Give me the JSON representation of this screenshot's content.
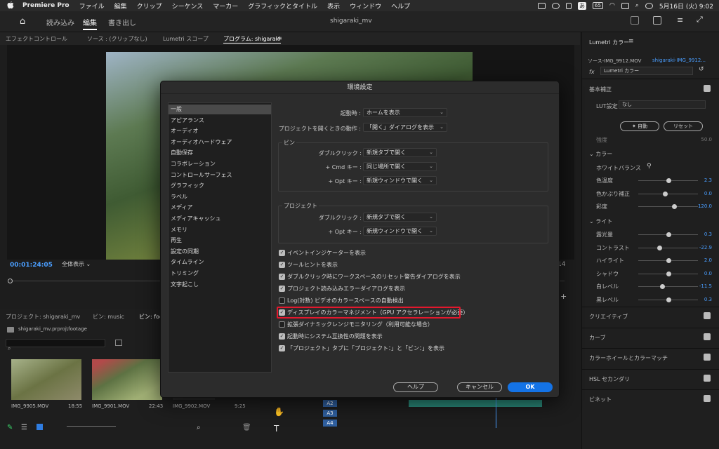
{
  "menubar": {
    "app": "Premiere Pro",
    "items": [
      "ファイル",
      "編集",
      "クリップ",
      "シーケンス",
      "マーカー",
      "グラフィックとタイトル",
      "表示",
      "ウィンドウ",
      "ヘルプ"
    ],
    "clock": "5月16日 (火)  9:02",
    "input_mode": "あ",
    "battery": "65"
  },
  "header": {
    "tabs": [
      "読み込み",
      "編集",
      "書き出し"
    ],
    "project": "shigaraki_mv"
  },
  "program": {
    "tabs": [
      "エフェクトコントロール",
      "ソース : (クリップなし)",
      "Lumetri スコープ",
      "プログラム: shigaraki"
    ],
    "timecode": "00:01:24:05",
    "zoom": "全体表示",
    "right_tc": "14"
  },
  "project": {
    "tabs": [
      "プロジェクト: shigaraki_mv",
      "ビン: music",
      "ビン: foo"
    ],
    "path": "shigaraki_mv.prproj\\footage",
    "clips": [
      {
        "name": "IMG_9905.MOV",
        "dur": "18:55"
      },
      {
        "name": "IMG_9901.MOV",
        "dur": "22:43"
      },
      {
        "name": "IMG_9902.MOV",
        "dur": "9:25"
      }
    ]
  },
  "lumetri": {
    "title": "Lumetri カラー",
    "source": "ソース-IMG_9912.MOV",
    "seq": "shigaraki-IMG_9912...",
    "fx": "Lumetri カラー",
    "basic": "基本補正",
    "lut_label": "LUT設定",
    "lut_value": "なし",
    "auto": "自動",
    "reset": "リセット",
    "intensity": "強度",
    "intensity_val": "50.0",
    "color": "カラー",
    "wb": "ホワイトバランス",
    "rows": [
      {
        "label": "色温度",
        "value": "2.3",
        "pos": 0.5
      },
      {
        "label": "色かぶり補正",
        "value": "0.0",
        "pos": 0.45
      },
      {
        "label": "彩度",
        "value": "120.0",
        "pos": 0.6
      }
    ],
    "light": "ライト",
    "light_rows": [
      {
        "label": "露光量",
        "value": "0.3",
        "pos": 0.5
      },
      {
        "label": "コントラスト",
        "value": "-22.9",
        "pos": 0.35
      },
      {
        "label": "ハイライト",
        "value": "2.0",
        "pos": 0.5
      },
      {
        "label": "シャドウ",
        "value": "0.0",
        "pos": 0.5
      },
      {
        "label": "白レベル",
        "value": "-11.5",
        "pos": 0.4
      },
      {
        "label": "黒レベル",
        "value": "0.3",
        "pos": 0.5
      }
    ],
    "sections": [
      "クリエイティブ",
      "カーブ",
      "カラーホイールとカラーマッチ",
      "HSL セカンダリ",
      "ビネット"
    ]
  },
  "timeline": {
    "tracks": [
      "A2",
      "A3",
      "A4"
    ]
  },
  "dialog": {
    "title": "環境設定",
    "categories": [
      "一般",
      "アピアランス",
      "オーディオ",
      "オーディオハードウェア",
      "自動保存",
      "コラボレーション",
      "コントロールサーフェス",
      "グラフィック",
      "ラベル",
      "メディア",
      "メディアキャッシュ",
      "メモリ",
      "再生",
      "設定の同期",
      "タイムライン",
      "トリミング",
      "文字起こし"
    ],
    "startup_label": "起動時 :",
    "startup_value": "ホームを表示",
    "open_label": "プロジェクトを開くときの動作 :",
    "open_value": "「開く」ダイアログを表示",
    "bin_title": "ビン",
    "bin_rows": [
      {
        "label": "ダブルクリック :",
        "value": "新規タブで開く"
      },
      {
        "label": "+ Cmd キー :",
        "value": "同じ場所で開く"
      },
      {
        "label": "+ Opt キー :",
        "value": "新規ウィンドウで開く"
      }
    ],
    "project_title": "プロジェクト",
    "project_rows": [
      {
        "label": "ダブルクリック :",
        "value": "新規タブで開く"
      },
      {
        "label": "+ Opt キー :",
        "value": "新規ウィンドウで開く"
      }
    ],
    "checks": [
      {
        "label": "イベントインジケーターを表示",
        "on": true
      },
      {
        "label": "ツールヒントを表示",
        "on": true
      },
      {
        "label": "ダブルクリック時にワークスペースのリセット警告ダイアログを表示",
        "on": true
      },
      {
        "label": "プロジェクト読み込みエラーダイアログを表示",
        "on": true
      },
      {
        "label": "Log(対数) ビデオのカラースペースの自動検出",
        "on": false
      },
      {
        "label": "ディスプレイのカラーマネジメント（GPU アクセラレーションが必要）",
        "on": true
      },
      {
        "label": "拡張ダイナミックレンジモニタリング（利用可能な場合）",
        "on": false
      },
      {
        "label": "起動時にシステム互換性の問題を表示",
        "on": true
      },
      {
        "label": "「プロジェクト」タブに「プロジェクト：」と「ビン：」を表示",
        "on": true
      }
    ],
    "help": "ヘルプ",
    "cancel": "キャンセル",
    "ok": "OK"
  }
}
